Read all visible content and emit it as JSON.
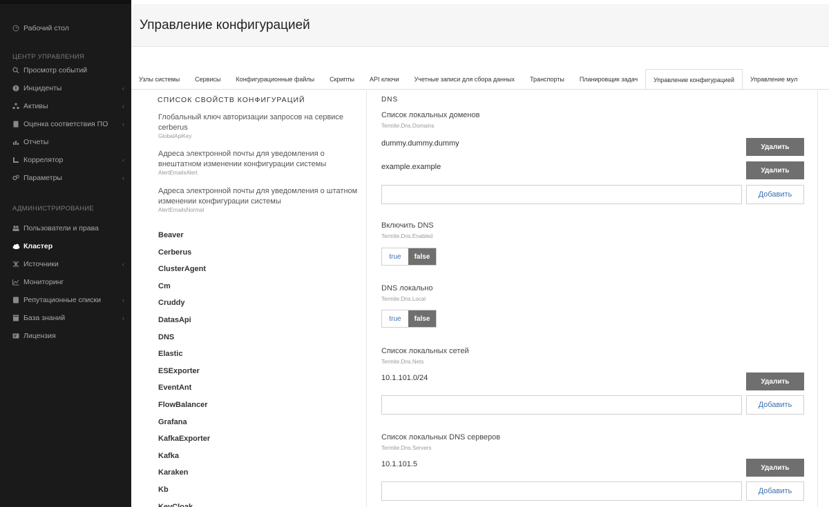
{
  "sidebar": {
    "top_item": "Рабочий стол",
    "section1": "ЦЕНТР УПРАВЛЕНИЯ",
    "items1": [
      {
        "label": "Просмотр событий",
        "icon": "search-icon",
        "chevron": false
      },
      {
        "label": "Инциденты",
        "icon": "alert-icon",
        "chevron": true
      },
      {
        "label": "Активы",
        "icon": "assets-icon",
        "chevron": true
      },
      {
        "label": "Оценка соответствия ПО",
        "icon": "document-icon",
        "chevron": true
      },
      {
        "label": "Отчеты",
        "icon": "bar-chart-icon",
        "chevron": false
      },
      {
        "label": "Коррелятор",
        "icon": "correlator-icon",
        "chevron": true
      },
      {
        "label": "Параметры",
        "icon": "gears-icon",
        "chevron": true
      }
    ],
    "section2": "АДМИНИСТРИРОВАНИЕ",
    "items2": [
      {
        "label": "Пользователи и права",
        "icon": "users-icon",
        "chevron": false
      },
      {
        "label": "Кластер",
        "icon": "cloud-icon",
        "chevron": false,
        "active": true
      },
      {
        "label": "Источники",
        "icon": "sources-icon",
        "chevron": true
      },
      {
        "label": "Мониторинг",
        "icon": "line-chart-icon",
        "chevron": false
      },
      {
        "label": "Репутационные списки",
        "icon": "list-icon",
        "chevron": true
      },
      {
        "label": "База знаний",
        "icon": "book-icon",
        "chevron": true
      },
      {
        "label": "Лицензия",
        "icon": "license-icon",
        "chevron": false
      }
    ]
  },
  "header": {
    "title": "Управление конфигурацией"
  },
  "tabs": [
    {
      "label": "Узлы системы"
    },
    {
      "label": "Сервисы"
    },
    {
      "label": "Конфигурационные файлы"
    },
    {
      "label": "Скрипты"
    },
    {
      "label": "API ключи"
    },
    {
      "label": "Учетные записи для сбора данных"
    },
    {
      "label": "Транспорты"
    },
    {
      "label": "Планировщик задач"
    },
    {
      "label": "Управление конфигурацией",
      "active": true
    },
    {
      "label": "Управление мул"
    }
  ],
  "list": {
    "title": "СПИСОК СВОЙСТВ КОНФИГУРАЦИЙ",
    "complex": [
      {
        "label": "Глобальный ключ авторизации запросов на сервисе cerberus",
        "key": "GlobalApiKey"
      },
      {
        "label": "Адреса электронной почты для уведомления о внештатном изменении конфигурации системы",
        "key": "AlertEmailsAlert"
      },
      {
        "label": "Адреса электронной почты для уведомления о штатном изменении конфигурации системы",
        "key": "AlertEmailsNormal"
      }
    ],
    "simple": [
      "Beaver",
      "Cerberus",
      "ClusterAgent",
      "Cm",
      "Cruddy",
      "DatasApi",
      "DNS",
      "Elastic",
      "ESExporter",
      "EventAnt",
      "FlowBalancer",
      "Grafana",
      "KafkaExporter",
      "Kafka",
      "Karaken",
      "Kb",
      "KeyCloak"
    ]
  },
  "detail": {
    "title": "DNS",
    "delete_label": "Удалить",
    "add_label": "Добавить",
    "true_label": "true",
    "false_label": "false",
    "domains": {
      "label": "Список локальных доменов",
      "key": "Termite.Dns.Domains",
      "values": [
        "dummy.dummy.dummy",
        "example.example"
      ]
    },
    "enabled": {
      "label": "Включить DNS",
      "key": "Termite.Dns.Enabled",
      "value": "false"
    },
    "local": {
      "label": "DNS локально",
      "key": "Termite.Dns.Local",
      "value": "false"
    },
    "nets": {
      "label": "Список локальных сетей",
      "key": "Termite.Dns.Nets",
      "values": [
        "10.1.101.0/24"
      ]
    },
    "servers": {
      "label": "Список локальных DNS серверов",
      "key": "Termite.Dns.Servers",
      "values": [
        "10.1.101.5"
      ]
    }
  }
}
